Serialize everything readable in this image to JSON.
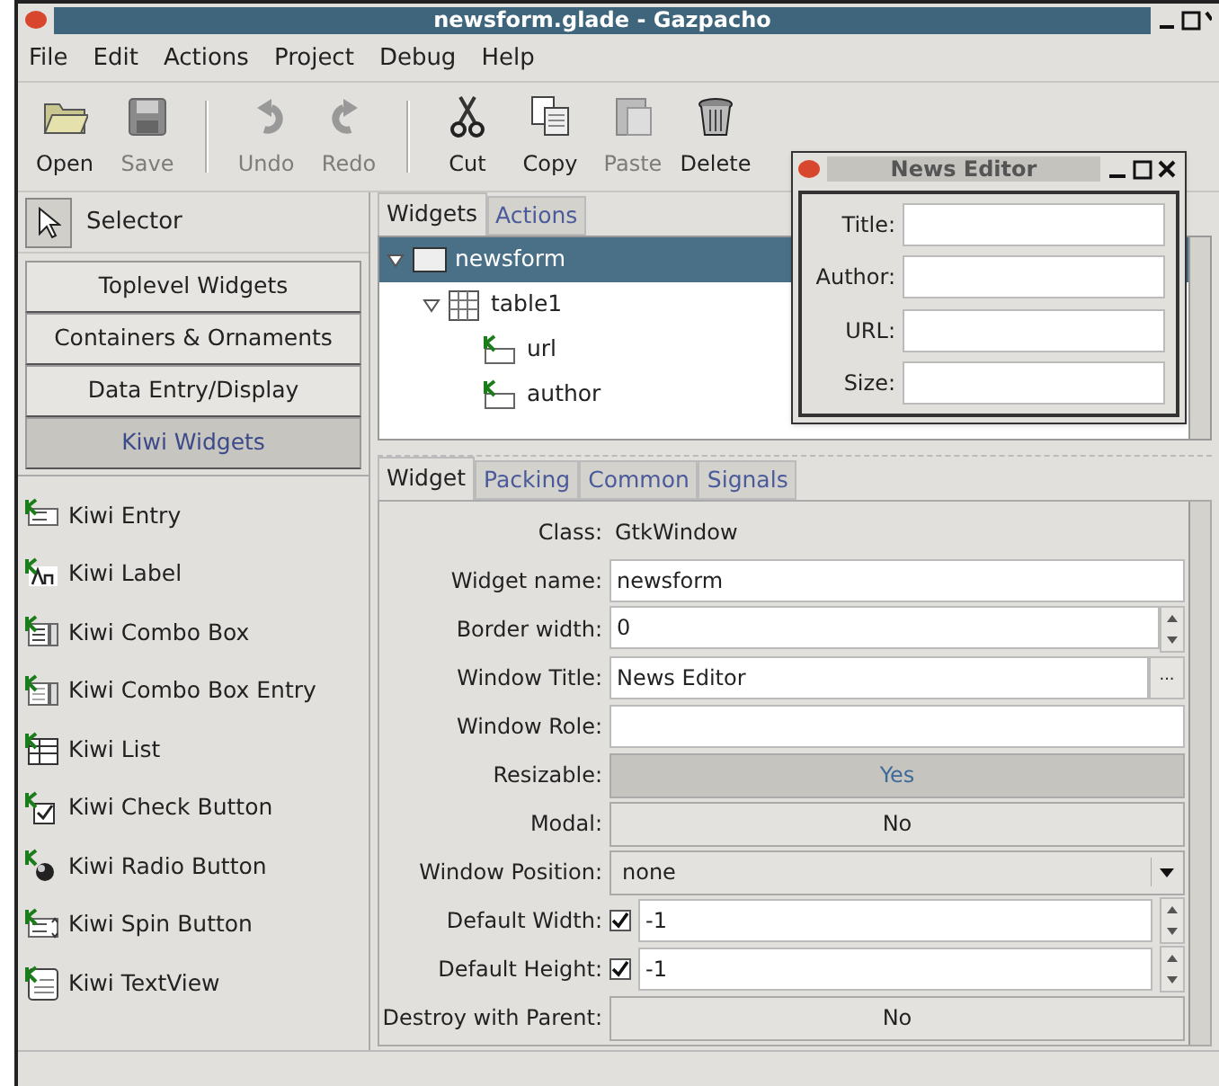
{
  "window": {
    "title": "newsform.glade - Gazpacho"
  },
  "menu": [
    "File",
    "Edit",
    "Actions",
    "Project",
    "Debug",
    "Help"
  ],
  "toolbar": [
    {
      "label": "Open",
      "disabled": false
    },
    {
      "label": "Save",
      "disabled": true,
      "separator_after": true
    },
    {
      "label": "Undo",
      "disabled": true
    },
    {
      "label": "Redo",
      "disabled": true,
      "separator_after": true
    },
    {
      "label": "Cut",
      "disabled": false
    },
    {
      "label": "Copy",
      "disabled": false
    },
    {
      "label": "Paste",
      "disabled": true
    },
    {
      "label": "Delete",
      "disabled": false
    }
  ],
  "palette": {
    "selector": "Selector",
    "groups": [
      {
        "label": "Toplevel Widgets",
        "selected": false
      },
      {
        "label": "Containers & Ornaments",
        "selected": false
      },
      {
        "label": "Data Entry/Display",
        "selected": false
      },
      {
        "label": "Kiwi Widgets",
        "selected": true
      }
    ],
    "items": [
      "Kiwi Entry",
      "Kiwi Label",
      "Kiwi Combo Box",
      "Kiwi Combo Box Entry",
      "Kiwi List",
      "Kiwi Check Button",
      "Kiwi Radio Button",
      "Kiwi Spin Button",
      "Kiwi TextView"
    ]
  },
  "tree_tabs": [
    {
      "label": "Widgets",
      "selected": true
    },
    {
      "label": "Actions",
      "selected": false
    }
  ],
  "tree": [
    {
      "label": "newsform",
      "selected": true,
      "expanded": true,
      "children": [
        {
          "label": "table1",
          "selected": false,
          "expanded": true,
          "children": [
            {
              "label": "url",
              "selected": false
            },
            {
              "label": "author",
              "selected": false
            }
          ]
        }
      ]
    }
  ],
  "property_tabs": [
    {
      "label": "Widget",
      "selected": true
    },
    {
      "label": "Packing",
      "selected": false
    },
    {
      "label": "Common",
      "selected": false
    },
    {
      "label": "Signals",
      "selected": false
    }
  ],
  "properties": [
    {
      "kind": "text",
      "label": "Class:",
      "value": "GtkWindow"
    },
    {
      "kind": "entry",
      "label": "Widget name:",
      "value": "newsform"
    },
    {
      "kind": "spin",
      "label": "Border width:",
      "value": "0"
    },
    {
      "kind": "dialog",
      "label": "Window Title:",
      "value": "News Editor",
      "button": "..."
    },
    {
      "kind": "entry",
      "label": "Window Role:"
    },
    {
      "kind": "toggle",
      "label": "Resizable:",
      "value": "Yes",
      "on": true
    },
    {
      "kind": "toggle",
      "label": "Modal:",
      "value": "No",
      "on": false
    },
    {
      "kind": "combo",
      "label": "Window Position:",
      "value": "none"
    },
    {
      "kind": "check_spin",
      "label": "Default Width:",
      "checked": true,
      "value": "-1"
    },
    {
      "kind": "check_spin",
      "label": "Default Height:",
      "checked": true,
      "value": "-1"
    },
    {
      "kind": "toggle",
      "label": "Destroy with Parent:",
      "value": "No",
      "on": false
    }
  ],
  "preview": {
    "title": "News Editor",
    "fields": [
      "Title:",
      "Author:",
      "URL:",
      "Size:"
    ]
  }
}
